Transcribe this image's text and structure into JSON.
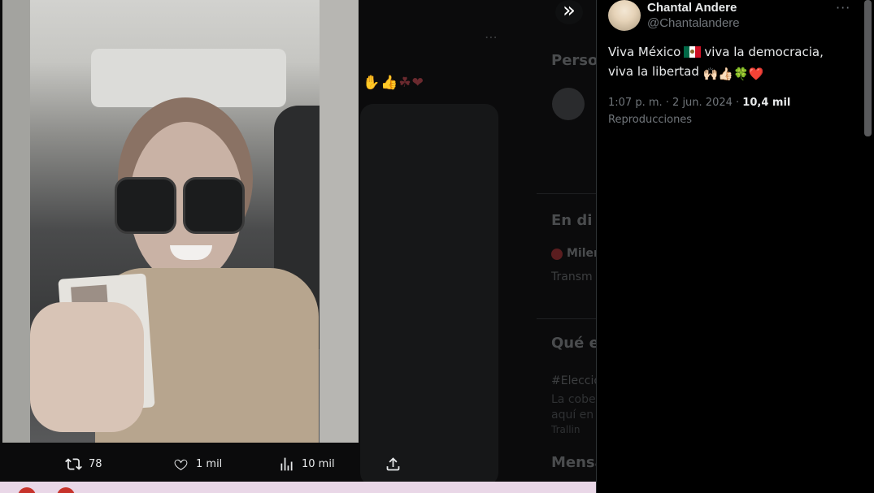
{
  "background": {
    "heading_1": "Perso",
    "heading_2": "En di",
    "heading_3": "Qué e",
    "heading_4": "Mensa",
    "item_live": "Miler",
    "item_trans": "Transm",
    "hashtag": "#Eleccio",
    "line_1": "La cobe",
    "line_2": "aquí en",
    "line_3": "Trallin",
    "emoji_row": "✋👍☘❤",
    "dots": "⋯"
  },
  "expand_icon": "»",
  "actions": {
    "retweets": "78",
    "likes": "1 mil",
    "views": "10 mil"
  },
  "post": {
    "display_name": "Chantal Andere",
    "handle": "@Chantalandere",
    "more": "···",
    "text_1": "Viva México",
    "text_2": "viva la democracia,",
    "text_3": "viva la libertad",
    "emojis_end": "🙌🏻👍🏻🍀❤️",
    "time": "1:07 p. m. · 2 jun. 2024 ·",
    "views_count": "10,4 mil",
    "views_label": "Reproducciones"
  },
  "colors": {
    "panel_bg": "#000000",
    "text_primary": "#e7e9ea",
    "text_secondary": "#71767b",
    "mexico_green": "#006847",
    "mexico_red": "#ce1126"
  }
}
